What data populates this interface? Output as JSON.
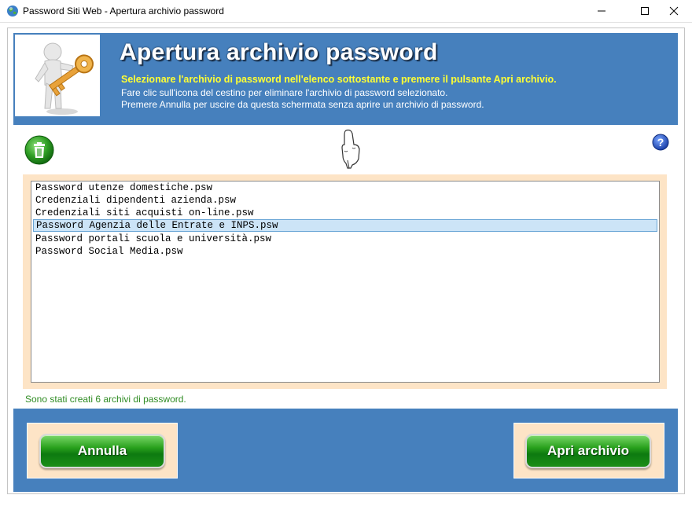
{
  "window": {
    "title": "Password Siti Web - Apertura archivio password",
    "minimize_glyph": "—",
    "maximize_glyph": "☐",
    "close_glyph": "✕"
  },
  "header": {
    "title": "Apertura archivio password",
    "line1": "Selezionare l'archivio di password nell'elenco sottostante e premere il pulsante Apri archivio.",
    "line2": "Fare clic sull'icona del cestino per eliminare l'archivio di password selezionato.",
    "line3": "Premere Annulla per uscire da questa schermata senza aprire un archivio di password."
  },
  "icons": {
    "app": "globe-icon",
    "header_image": "person-with-key-icon",
    "trash": "trash-icon",
    "hand": "pointing-hand-icon",
    "help": "help-icon"
  },
  "files": [
    {
      "name": "Password utenze domestiche.psw",
      "selected": false
    },
    {
      "name": "Credenziali dipendenti azienda.psw",
      "selected": false
    },
    {
      "name": "Credenziali siti acquisti on-line.psw",
      "selected": false
    },
    {
      "name": "Password Agenzia delle Entrate e INPS.psw",
      "selected": true
    },
    {
      "name": "Password portali scuola e università.psw",
      "selected": false
    },
    {
      "name": "Password Social Media.psw",
      "selected": false
    }
  ],
  "status_text": "Sono stati creati 6 archivi di password.",
  "buttons": {
    "cancel": "Annulla",
    "open": "Apri archivio"
  },
  "colors": {
    "header_blue": "#4680bd",
    "panel_peach": "#fde4c6",
    "status_green": "#2e8b22",
    "subtitle_yellow": "#ffff33",
    "button_green": "#1b8e17"
  }
}
